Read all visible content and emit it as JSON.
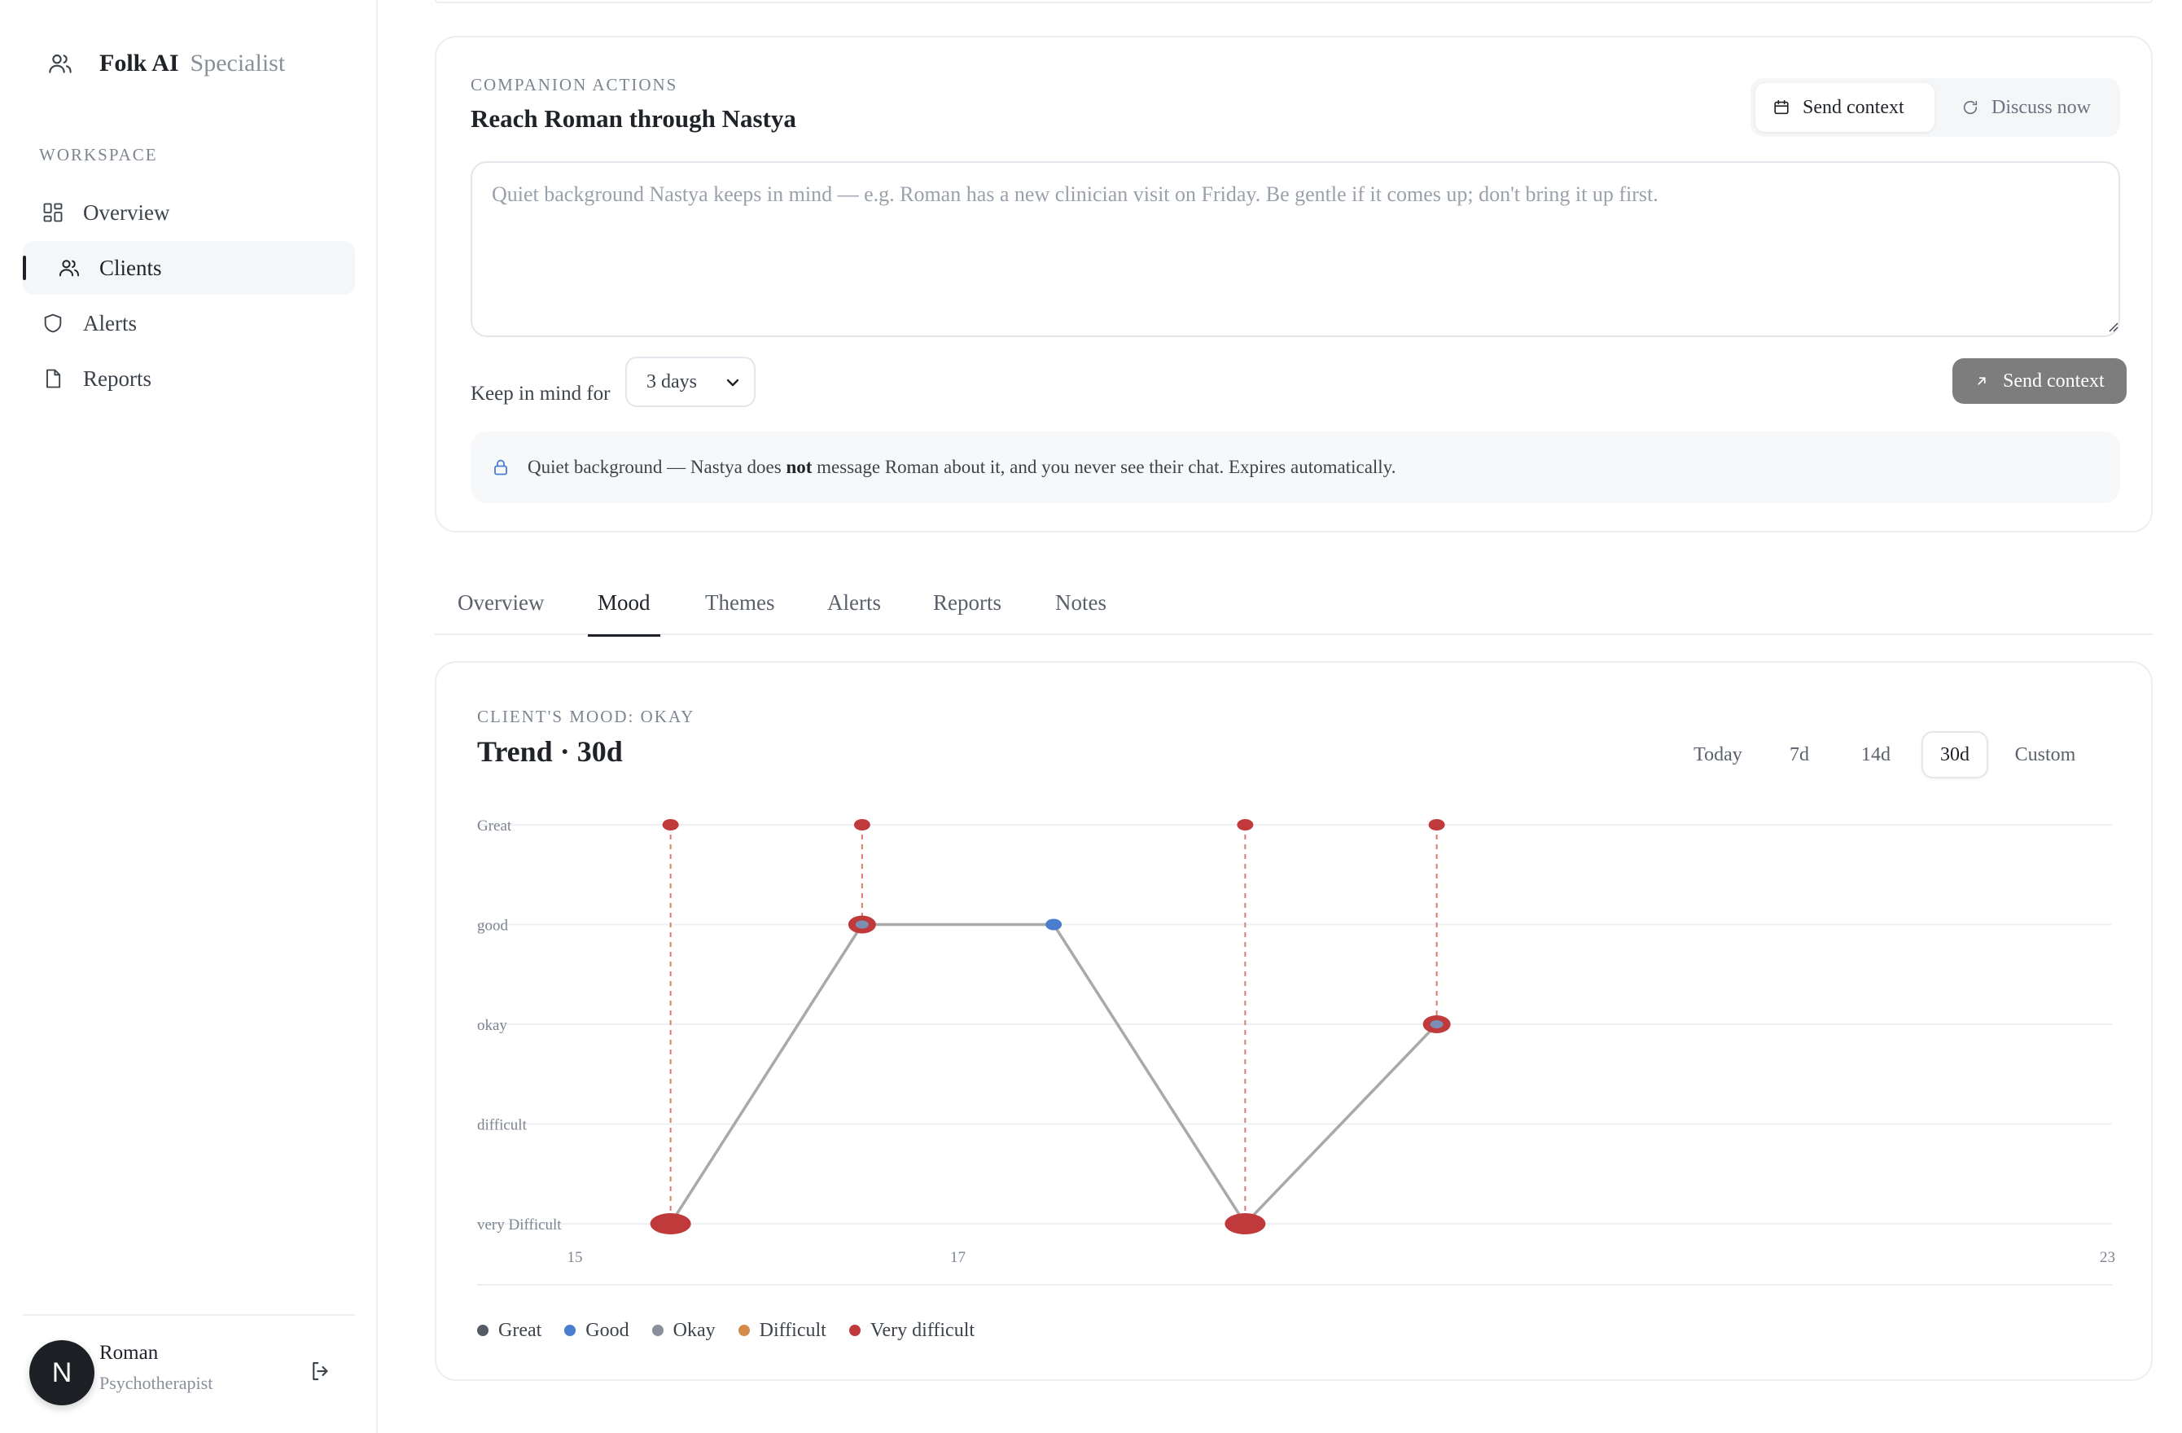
{
  "brand": {
    "name": "Folk AI",
    "sub": "Specialist"
  },
  "sidebar": {
    "section_label": "WORKSPACE",
    "items": [
      {
        "label": "Overview",
        "icon": "grid-icon"
      },
      {
        "label": "Clients",
        "icon": "users-icon"
      },
      {
        "label": "Alerts",
        "icon": "shield-icon"
      },
      {
        "label": "Reports",
        "icon": "file-icon"
      }
    ],
    "active_index": 1
  },
  "user": {
    "initial": "N",
    "name": "Roman",
    "role": "Psychotherapist"
  },
  "companion": {
    "eyebrow": "COMPANION ACTIONS",
    "title": "Reach Roman through Nastya",
    "modes": {
      "active": "Send context",
      "inactive": "Discuss now"
    },
    "textarea_placeholder": "Quiet background Nastya keeps in mind — e.g. Roman has a new clinician visit on Friday. Be gentle if it comes up; don't bring it up first.",
    "keep_label": "Keep in mind for",
    "keep_value": "3 days",
    "send_label": "Send context",
    "notice_pre": "Quiet background — Nastya does ",
    "notice_bold": "not",
    "notice_post": " message Roman about it, and you never see their chat. Expires automatically."
  },
  "tabs": [
    "Overview",
    "Mood",
    "Themes",
    "Alerts",
    "Reports",
    "Notes"
  ],
  "active_tab": "Mood",
  "mood": {
    "eyebrow": "CLIENT'S MOOD: OKAY",
    "title": "Trend · 30d",
    "ranges": [
      "Today",
      "7d",
      "14d",
      "30d",
      "Custom"
    ],
    "active_range": "30d"
  },
  "chart_data": {
    "type": "line",
    "y_levels": [
      "very Difficult",
      "difficult",
      "okay",
      "good",
      "Great"
    ],
    "x_tick_labels": [
      "15",
      "17",
      "23"
    ],
    "points": [
      {
        "x": 15.5,
        "y": "very Difficult",
        "color": "red",
        "flag": "Great"
      },
      {
        "x": 16.5,
        "y": "good",
        "color": "red",
        "flag": "Great"
      },
      {
        "x": 17.5,
        "y": "good",
        "color": "blue",
        "flag": null
      },
      {
        "x": 18.5,
        "y": "very Difficult",
        "color": "red",
        "flag": "Great"
      },
      {
        "x": 19.5,
        "y": "okay",
        "color": "red",
        "flag": "Great"
      }
    ],
    "legend": [
      {
        "label": "Great",
        "color": "#555b65"
      },
      {
        "label": "Good",
        "color": "#4a7ccf"
      },
      {
        "label": "Okay",
        "color": "#8a9099"
      },
      {
        "label": "Difficult",
        "color": "#d48a4a"
      },
      {
        "label": "Very difficult",
        "color": "#c0393b"
      }
    ],
    "grid": true,
    "legend_position": "bottom-left"
  }
}
